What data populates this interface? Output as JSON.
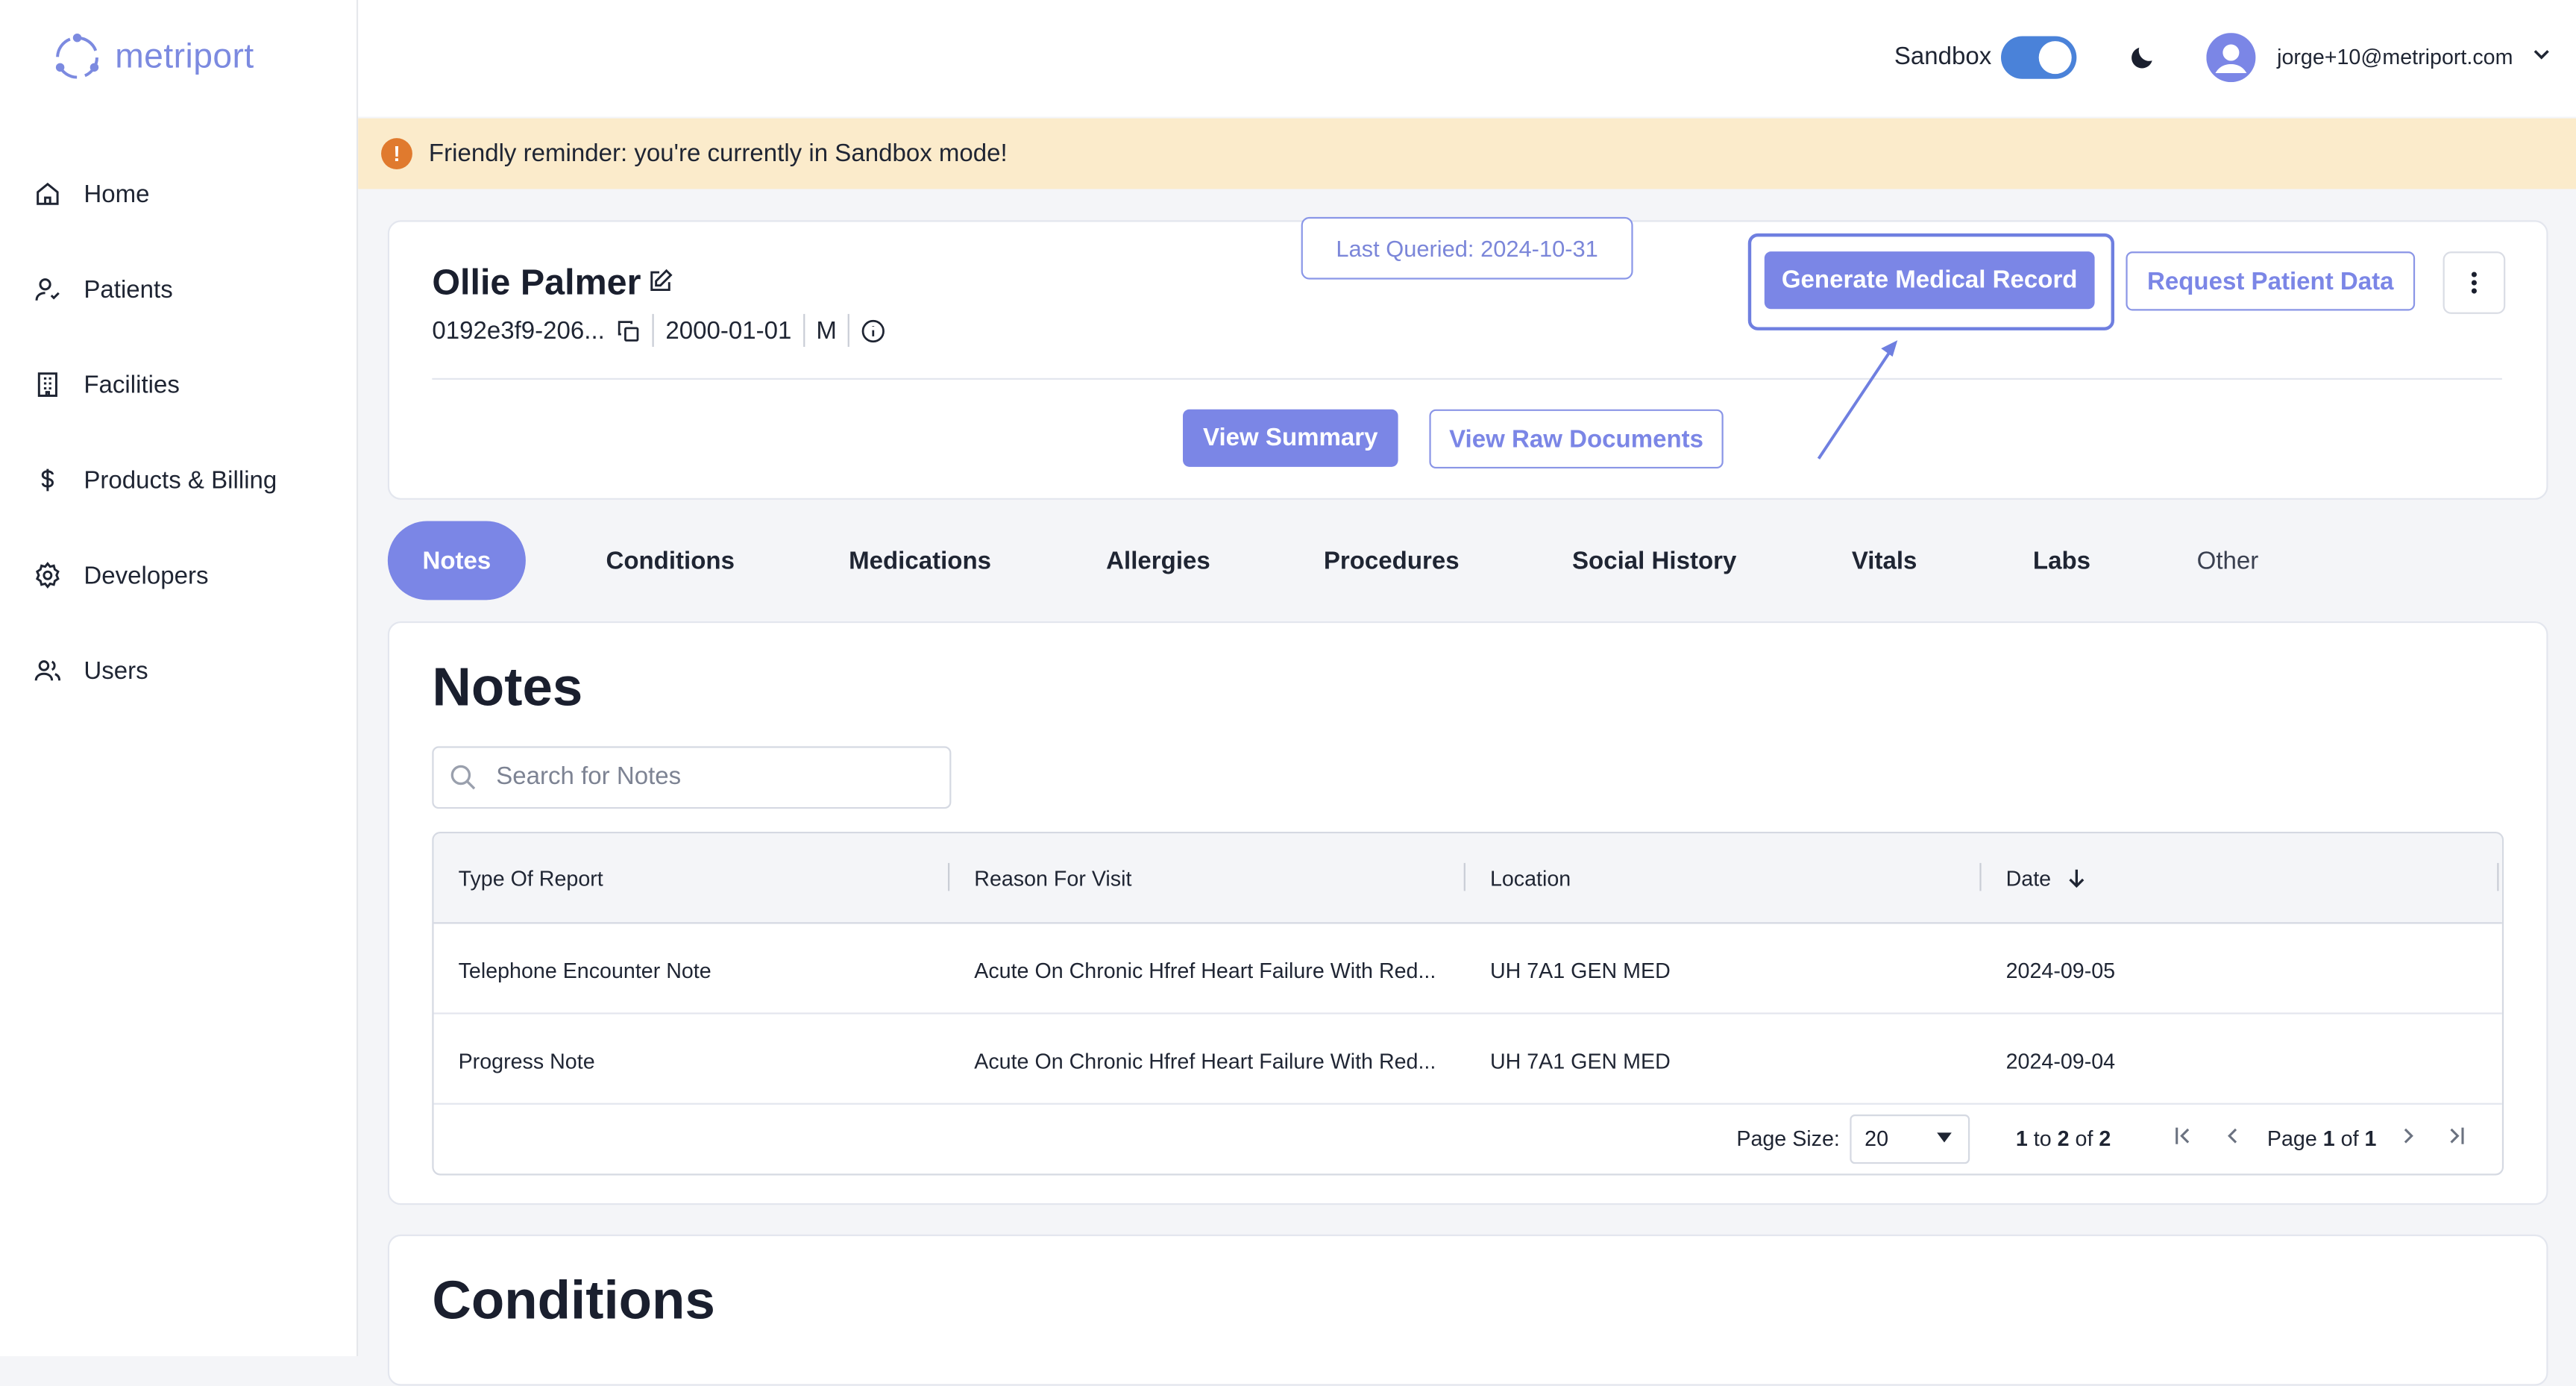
{
  "app": {
    "logo_text": "metriport"
  },
  "sidebar": {
    "items": [
      {
        "label": "Home",
        "icon": "home-icon"
      },
      {
        "label": "Patients",
        "icon": "patient-icon"
      },
      {
        "label": "Facilities",
        "icon": "building-icon"
      },
      {
        "label": "Products & Billing",
        "icon": "dollar-icon"
      },
      {
        "label": "Developers",
        "icon": "gear-icon"
      },
      {
        "label": "Users",
        "icon": "users-icon"
      }
    ]
  },
  "header": {
    "sandbox_label": "Sandbox",
    "sandbox_enabled": true,
    "user_email": "jorge+10@metriport.com"
  },
  "banner": {
    "text": "Friendly reminder: you're currently in Sandbox mode!",
    "icon": "!"
  },
  "patient": {
    "name": "Ollie Palmer",
    "id": "0192e3f9-206...",
    "dob": "2000-01-01",
    "gender": "M",
    "last_queried": "Last Queried: 2024-10-31",
    "generate_label": "Generate Medical Record",
    "request_label": "Request Patient Data",
    "view_summary_label": "View Summary",
    "view_raw_label": "View Raw Documents"
  },
  "tabs": [
    {
      "label": "Notes",
      "active": true
    },
    {
      "label": "Conditions"
    },
    {
      "label": "Medications"
    },
    {
      "label": "Allergies"
    },
    {
      "label": "Procedures"
    },
    {
      "label": "Social History"
    },
    {
      "label": "Vitals"
    },
    {
      "label": "Labs"
    },
    {
      "label": "Other"
    }
  ],
  "notes": {
    "title": "Notes",
    "search_placeholder": "Search for Notes",
    "columns": [
      "Type Of Report",
      "Reason For Visit",
      "Location",
      "Date"
    ],
    "rows": [
      {
        "type": "Telephone Encounter Note",
        "reason": "Acute On Chronic Hfref Heart Failure With Red...",
        "location": "UH 7A1 GEN MED",
        "date": "2024-09-05"
      },
      {
        "type": "Progress Note",
        "reason": "Acute On Chronic Hfref Heart Failure With Red...",
        "location": "UH 7A1 GEN MED",
        "date": "2024-09-04"
      }
    ],
    "page_size_label": "Page Size:",
    "page_size": "20",
    "range_from": "1",
    "range_to": "2",
    "range_total": "2",
    "range_to_word": "to",
    "range_of_word": "of",
    "page_word": "Page",
    "page_current": "1",
    "page_total": "1"
  },
  "conditions": {
    "title": "Conditions"
  },
  "colors": {
    "accent": "#7b86e6",
    "banner_bg": "#fbebcb",
    "toggle": "#4a82d9",
    "warning": "#e07a2e"
  }
}
